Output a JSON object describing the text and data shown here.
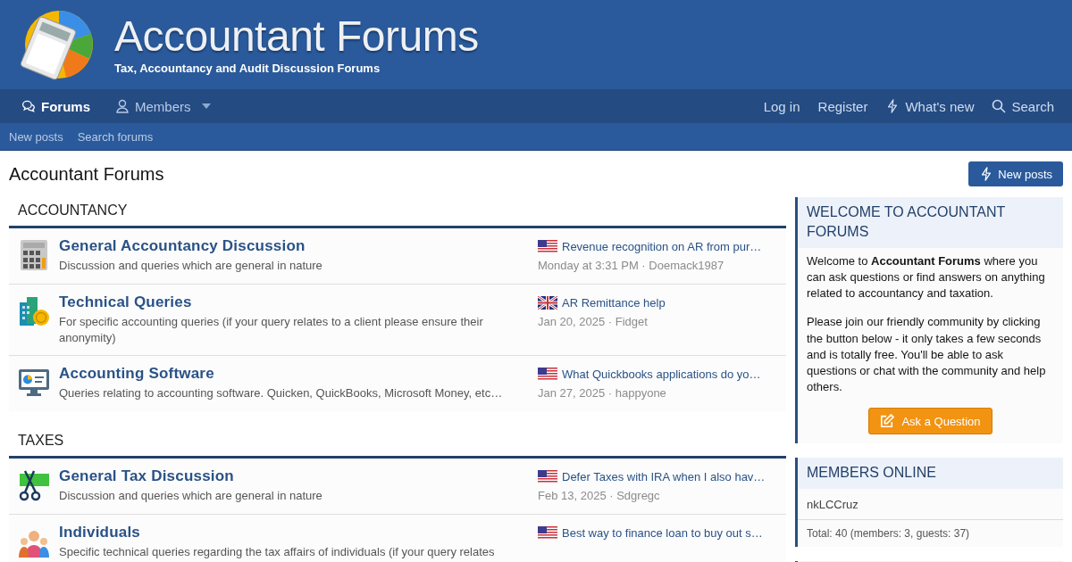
{
  "header": {
    "title": "Accountant Forums",
    "tagline": "Tax, Accountancy and Audit Discussion Forums"
  },
  "nav": {
    "tabs": [
      {
        "label": "Forums",
        "kind": "forums",
        "selected": true
      },
      {
        "label": "Members",
        "kind": "members",
        "selected": false
      }
    ],
    "right": [
      {
        "label": "Log in",
        "kind": "plain"
      },
      {
        "label": "Register",
        "kind": "plain"
      },
      {
        "label": "What's new",
        "kind": "whatsnew"
      },
      {
        "label": "Search",
        "kind": "search"
      }
    ]
  },
  "subnav": [
    "New posts",
    "Search forums"
  ],
  "page_title": "Accountant Forums",
  "new_posts_button": "New posts",
  "categories": [
    {
      "title": "ACCOUNTANCY",
      "forums": [
        {
          "kind": "calculator",
          "title": "General Accountancy Discussion",
          "description": "Discussion and queries which are general in nature",
          "latest": {
            "kind": "us",
            "title": "Revenue recognition on AR from pur…",
            "meta": "Monday at 3:31 PM · Doemack1987"
          }
        },
        {
          "kind": "building",
          "title": "Technical Queries",
          "description": "For specific accounting queries (if your query relates to a client please ensure their anonymity)",
          "latest": {
            "kind": "uk",
            "title": "AR Remittance help",
            "meta": "Jan 20, 2025 · Fidget"
          }
        },
        {
          "kind": "monitor",
          "title": "Accounting Software",
          "description": "Queries relating to accounting software. Quicken, QuickBooks, Microsoft Money, etc…",
          "latest": {
            "kind": "us",
            "title": "What Quickbooks applications do yo…",
            "meta": "Jan 27, 2025 · happyone"
          }
        }
      ]
    },
    {
      "title": "TAXES",
      "forums": [
        {
          "kind": "tax",
          "title": "General Tax Discussion",
          "description": "Discussion and queries which are general in nature",
          "latest": {
            "kind": "us",
            "title": "Defer Taxes with IRA when I also hav…",
            "meta": "Feb 13, 2025 · Sdgregc"
          }
        },
        {
          "kind": "people",
          "title": "Individuals",
          "description": "Specific technical queries regarding the tax affairs of individuals (if your query relates",
          "latest": {
            "kind": "us",
            "title": "Best way to finance loan to buy out s…"
          }
        }
      ]
    }
  ],
  "sidebar": {
    "welcome": {
      "title": "WELCOME TO ACCOUNTANT FORUMS",
      "paragraphs": [
        "Welcome to **Accountant Forums** where you can ask questions or find answers on anything related to accountancy and taxation.",
        "Please join our friendly community by clicking the button below - it only takes a few seconds and is totally free. You'll be able to ask questions or chat with the community and help others."
      ],
      "button": "Ask a Question"
    },
    "members_online": {
      "title": "MEMBERS ONLINE",
      "members": [
        "nkLCCruz"
      ],
      "total": "Total: 40 (members: 3, guests: 37)"
    }
  }
}
